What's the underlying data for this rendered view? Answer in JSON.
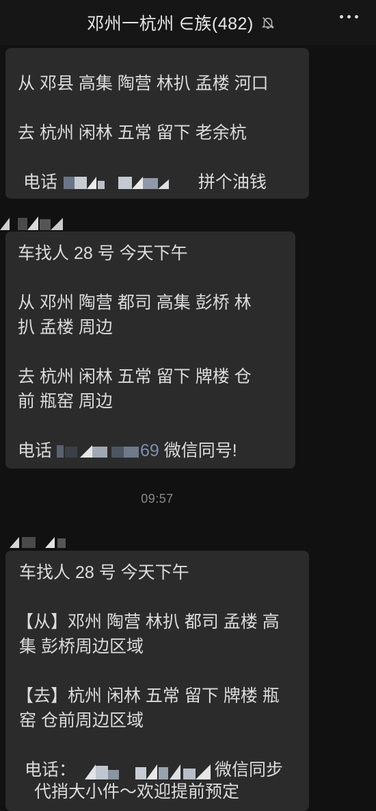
{
  "header": {
    "title": "邓州一杭州 ∈族(482)",
    "muted_icon": "bell-slash-icon",
    "more_icon": "more-dots-icon"
  },
  "messages": [
    {
      "lines": [
        "从 邓县 高集 陶营 林扒 孟楼 河口",
        "",
        "去 杭州 闲林 五常 留下 老余杭"
      ],
      "phone_label": "电话",
      "phone_suffix": "拼个油钱"
    },
    {
      "lines": [
        "车找人 28 号 今天下午",
        "",
        "从  邓州 陶营 都司 高集 彭桥 林",
        "扒 孟楼 周边",
        "",
        "去  杭州 闲林 五常 留下 牌楼 仓",
        "前 瓶窑 周边"
      ],
      "phone_label": "电话",
      "phone_tail": "69",
      "phone_suffix": "微信同号!"
    },
    {
      "lines": [
        "车找人 28 号 今天下午",
        "",
        "【从】邓州 陶营 林扒 都司 孟楼 高",
        "集 彭桥周边区域",
        "",
        "【去】杭州 闲林 五常 留下 牌楼  瓶",
        "窑 仓前周边区域"
      ],
      "phone_label": "电话：",
      "phone_suffix": "微信同步",
      "extra": "代捎大小件～欢迎提前预定"
    }
  ],
  "timestamp": "09:57"
}
